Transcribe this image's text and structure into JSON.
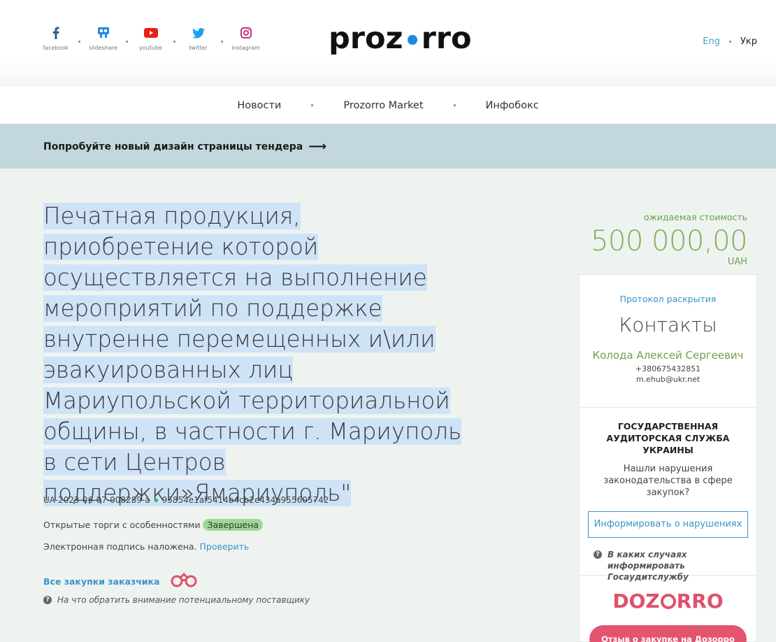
{
  "header": {
    "socials": [
      {
        "name": "facebook",
        "icon": "facebook-icon",
        "color": "#3b5998"
      },
      {
        "name": "slideshare",
        "icon": "slideshare-icon",
        "color": "#1e88e5"
      },
      {
        "name": "youtube",
        "icon": "youtube-icon",
        "color": "#e62117"
      },
      {
        "name": "twitter",
        "icon": "twitter-icon",
        "color": "#1da1f2"
      },
      {
        "name": "instagram",
        "icon": "instagram-icon",
        "color": "#c13584"
      }
    ],
    "logo_left": "proz",
    "logo_right": "rro",
    "lang_eng": "Eng",
    "lang_ukr": "Укр"
  },
  "nav": {
    "items": [
      "Новости",
      "Prozorro Market",
      "Инфобокс"
    ]
  },
  "banner": {
    "text": "Попробуйте новый дизайн страницы тендера",
    "arrow": "⟶"
  },
  "tender": {
    "title": "Печатная продукция, приобретение которой осуществляется на выполнение мероприятий по поддержке внутренне перемещенных и\\или эвакуированных лиц Мариупольской территориальной общины, в частности г. Мариуполь в сети Центров поддержки»Ямариуполь\"",
    "id": "UA-2023-06-07-008289-a",
    "hash": "95854e1af5414b4cb2e434a955605742",
    "procedure": "Открытые торги с особенностями",
    "status": "Завершена",
    "signature_text": "Электронная подпись наложена.",
    "signature_link": "Проверить",
    "all_purchases": "Все закупки заказчика",
    "supplier_hint": "На что обратить внимание потенциальному поставщику"
  },
  "value": {
    "label": "ожидаемая стоимость",
    "amount": "500 000,00",
    "currency": "UAH"
  },
  "contacts": {
    "protocol_link": "Протокол раскрытия",
    "heading": "Контакты",
    "person": "Колода Алексей Сергеевич",
    "phone": "+380675432851",
    "email": "m.ehub@ukr.net"
  },
  "audit": {
    "heading": "ГОСУДАРСТВЕННАЯ АУДИТОРСКАЯ СЛУЖБА УКРАИНЫ",
    "question": "Нашли нарушения законодательства в сфере закупок?",
    "button": "Информировать о нарушениях",
    "hint": "В каких случаях информировать Госаудитслужбу"
  },
  "dozorro": {
    "logo_left": "DO",
    "logo_mid": "Z",
    "logo_right": "RRO",
    "button": "Отзыв о закупке на Дозорро"
  },
  "colors": {
    "accent_blue": "#3a95c9",
    "accent_green": "#6aa24f",
    "dozorro_red": "#e0506b",
    "banner_bg": "#c3d7de",
    "highlight": "#cfe3f7"
  }
}
